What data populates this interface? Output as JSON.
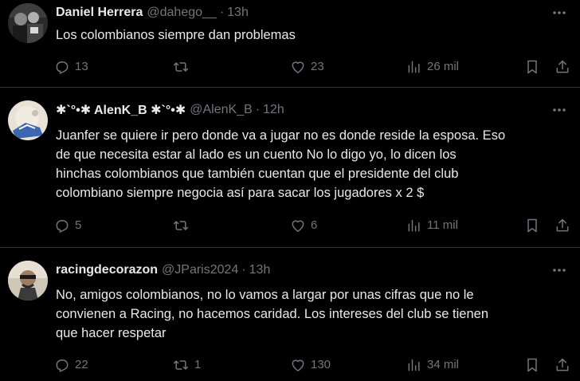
{
  "tweets": [
    {
      "name": "Daniel Herrera",
      "handle": "@dahego__",
      "separator": "·",
      "time": "13h",
      "text": "Los colombianos siempre dan problemas",
      "replies": "13",
      "retweets": "",
      "likes": "23",
      "views": "26 mil"
    },
    {
      "name": "✱`°•✱ AlenK_B ✱`°•✱",
      "handle": "@AlenK_B",
      "separator": "·",
      "time": "12h",
      "text": "Juanfer se quiere ir pero donde va a jugar no es donde reside la esposa. Eso\nde que necesita estar al lado es un cuento No lo digo yo, lo dicen los\nhinchas colombianos que también cuentan que el presidente del club\ncolombiano siempre negocia así para sacar los jugadores x 2 $",
      "replies": "5",
      "retweets": "",
      "likes": "6",
      "views": "11 mil"
    },
    {
      "name": "racingdecorazon",
      "handle": "@JParis2024",
      "separator": "·",
      "time": "13h",
      "text": "No, amigos colombianos, no lo vamos a largar por unas cifras que no le\nconvienen a Racing, no hacemos caridad. Los intereses del club se tienen\nque hacer respetar",
      "replies": "22",
      "retweets": "1",
      "likes": "130",
      "views": "34 mil"
    }
  ],
  "icons": {
    "reply": "reply-icon",
    "retweet": "retweet-icon",
    "like": "heart-icon",
    "views": "views-icon",
    "bookmark": "bookmark-icon",
    "share": "share-icon",
    "more": "more-icon"
  },
  "colors": {
    "background": "#000000",
    "text": "#e7e9ea",
    "muted": "#71767b",
    "divider": "#2f3336"
  }
}
